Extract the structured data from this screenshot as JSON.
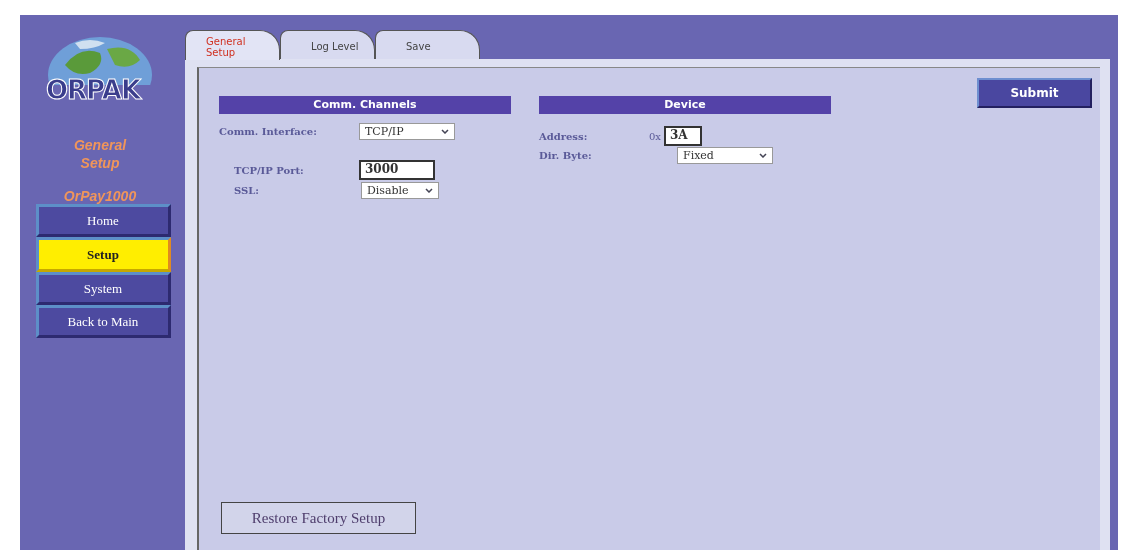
{
  "logo": {
    "text": "ORPAK"
  },
  "sidebar": {
    "section_title": "General Setup",
    "device": "OrPay1000",
    "items": [
      {
        "label": "Home",
        "selected": false
      },
      {
        "label": "Setup",
        "selected": true
      },
      {
        "label": "System",
        "selected": false
      },
      {
        "label": "Back to Main",
        "selected": false
      }
    ]
  },
  "tabs": [
    {
      "label": "General Setup",
      "selected": true
    },
    {
      "label": "Log Level",
      "selected": false
    },
    {
      "label": "Save",
      "selected": false
    }
  ],
  "submit": "Submit",
  "comm_channels": {
    "title": "Comm. Channels",
    "interface": {
      "label": "Comm. Interface:",
      "value": "TCP/IP"
    },
    "port": {
      "label": "TCP/IP Port:",
      "value": "3000"
    },
    "ssl": {
      "label": "SSL:",
      "value": "Disable"
    }
  },
  "device": {
    "title": "Device",
    "address": {
      "label": "Address:",
      "prefix": "0x",
      "value": "3A"
    },
    "dir_byte": {
      "label": "Dir. Byte:",
      "value": "Fixed"
    }
  },
  "restore": "Restore Factory Setup"
}
